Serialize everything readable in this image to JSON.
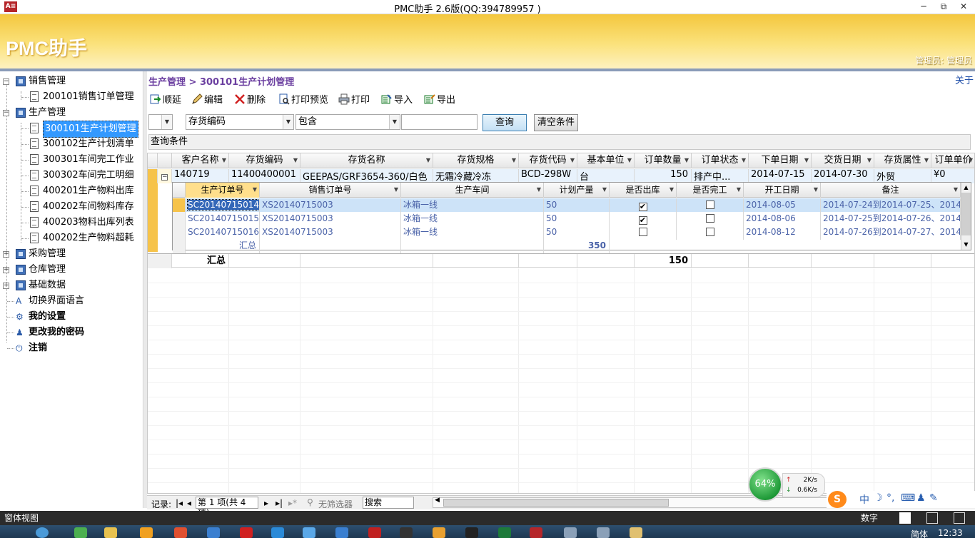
{
  "window": {
    "title": "PMC助手 2.6版(QQ:394789957 )",
    "icon_label": "A≡",
    "minimize": "─",
    "restore": "⧉",
    "close": "✕"
  },
  "banner": {
    "app_name": "PMC助手",
    "user_info": "管理员: 管理员"
  },
  "tree": {
    "items": [
      {
        "label": "销售管理",
        "level": 0,
        "expander": "−",
        "icon": "folder-icon"
      },
      {
        "label": "200101销售订单管理",
        "level": 1,
        "icon": "document-icon"
      },
      {
        "label": "生产管理",
        "level": 0,
        "expander": "−",
        "icon": "folder-icon"
      },
      {
        "label": "300101生产计划管理",
        "level": 1,
        "icon": "document-icon",
        "selected": true
      },
      {
        "label": "300102生产计划清单",
        "level": 1,
        "icon": "document-icon"
      },
      {
        "label": "300301车间完工作业",
        "level": 1,
        "icon": "document-icon"
      },
      {
        "label": "300302车间完工明细",
        "level": 1,
        "icon": "document-icon"
      },
      {
        "label": "400201生产物料出库",
        "level": 1,
        "icon": "document-icon"
      },
      {
        "label": "400202车间物料库存",
        "level": 1,
        "icon": "document-icon"
      },
      {
        "label": "400203物料出库列表",
        "level": 1,
        "icon": "document-icon"
      },
      {
        "label": "400202生产物料超耗",
        "level": 1,
        "icon": "document-icon"
      },
      {
        "label": "采购管理",
        "level": 0,
        "expander": "+",
        "icon": "folder-icon"
      },
      {
        "label": "仓库管理",
        "level": 0,
        "expander": "+",
        "icon": "folder-icon"
      },
      {
        "label": "基础数据",
        "level": 0,
        "expander": "+",
        "icon": "folder-icon"
      },
      {
        "label": "切换界面语言",
        "level": 0,
        "icon": "language-icon"
      },
      {
        "label": "我的设置",
        "level": 0,
        "icon": "settings-icon",
        "bold": true
      },
      {
        "label": "更改我的密码",
        "level": 0,
        "icon": "user-key-icon",
        "bold": true
      },
      {
        "label": "注销",
        "level": 0,
        "icon": "logout-icon",
        "bold": true
      }
    ]
  },
  "main": {
    "breadcrumb": "生产管理 > 300101生产计划管理",
    "about": "关于",
    "toolbar": [
      {
        "label": "顺延",
        "icon": "postpone-icon"
      },
      {
        "label": "编辑",
        "icon": "edit-icon"
      },
      {
        "label": "删除",
        "icon": "delete-icon"
      },
      {
        "label": "打印预览",
        "icon": "print-preview-icon"
      },
      {
        "label": "打印",
        "icon": "print-icon"
      },
      {
        "label": "导入",
        "icon": "import-icon"
      },
      {
        "label": "导出",
        "icon": "export-icon"
      }
    ],
    "filter": {
      "field_select": "存货编码",
      "operator_select": "包含",
      "query_button": "查询",
      "clear_button": "清空条件"
    },
    "query_conditions": "查询条件"
  },
  "grid": {
    "columns": [
      "客户名称",
      "存货编码",
      "存货名称",
      "存货规格",
      "存货代码",
      "基本单位",
      "订单数量",
      "订单状态",
      "下单日期",
      "交货日期",
      "存货属性",
      "订单单价"
    ],
    "row": {
      "cells": [
        "140719",
        "11400400001",
        "GEEPAS/GRF3654-360/白色",
        "无霜冷藏冷冻箱/BEI",
        "BCD-298W",
        "台",
        "150",
        "排产中...",
        "2014-07-15",
        "2014-07-30",
        "外贸",
        "¥0"
      ]
    },
    "summary_label": "汇总",
    "summary_qty": "150",
    "sub": {
      "columns": [
        "生产订单号",
        "销售订单号",
        "生产车间",
        "计划产量",
        "是否出库",
        "是否完工",
        "开工日期",
        "备注"
      ],
      "rows": [
        {
          "order": "SC20140715014",
          "sales": "XS20140715003",
          "workshop": "冰箱一线",
          "qty": "50",
          "out": true,
          "done": false,
          "start": "2014-08-05",
          "note": "2014-07-24到2014-07-25、2014-0"
        },
        {
          "order": "SC20140715015",
          "sales": "XS20140715003",
          "workshop": "冰箱一线",
          "qty": "50",
          "out": true,
          "done": false,
          "start": "2014-08-06",
          "note": "2014-07-25到2014-07-26、2014-0"
        },
        {
          "order": "SC20140715016",
          "sales": "XS20140715003",
          "workshop": "冰箱一线",
          "qty": "50",
          "out": false,
          "done": false,
          "start": "2014-08-12",
          "note": "2014-07-26到2014-07-27、2014-0"
        }
      ],
      "summary_label": "汇总",
      "summary_qty": "350"
    },
    "nav": {
      "records_label": "记录:",
      "first": "|◂",
      "prev": "◂",
      "position": "第 1 项(共 4 项)",
      "next": "▸",
      "last": "▸|",
      "new": "▸*",
      "filter": "无筛选器",
      "search": "搜索"
    }
  },
  "widget": {
    "percent": "64%",
    "up": "2K/s",
    "down": "0.6K/s"
  },
  "ime": {
    "lang": "中",
    "moon": "☽",
    "punct": "°,",
    "keyboard": "⌨",
    "person": "♟",
    "tool": "✎"
  },
  "statusbar": {
    "view": "窗体视图",
    "mode": "数字"
  },
  "taskbar": {
    "time": "12:33",
    "lang": "简体"
  }
}
